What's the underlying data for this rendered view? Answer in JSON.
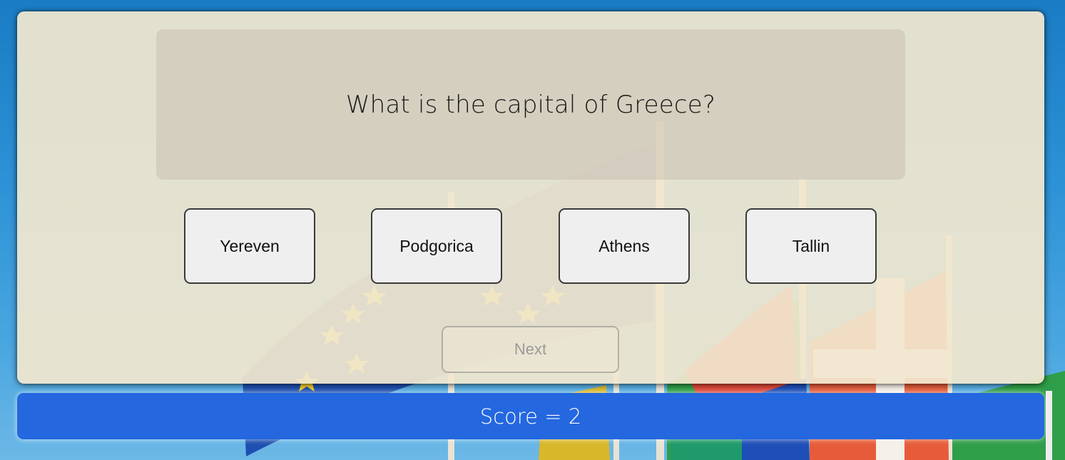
{
  "quiz": {
    "question": "What is the capital of Greece?",
    "answers": [
      {
        "label": "Yereven"
      },
      {
        "label": "Podgorica"
      },
      {
        "label": "Athens"
      },
      {
        "label": "Tallin"
      }
    ],
    "next_label": "Next"
  },
  "score": {
    "text": "Score = 2"
  },
  "theme": {
    "score_bar_color": "#2467df",
    "card_color": "#f1e7cf",
    "background_color": "#2d92d6"
  }
}
